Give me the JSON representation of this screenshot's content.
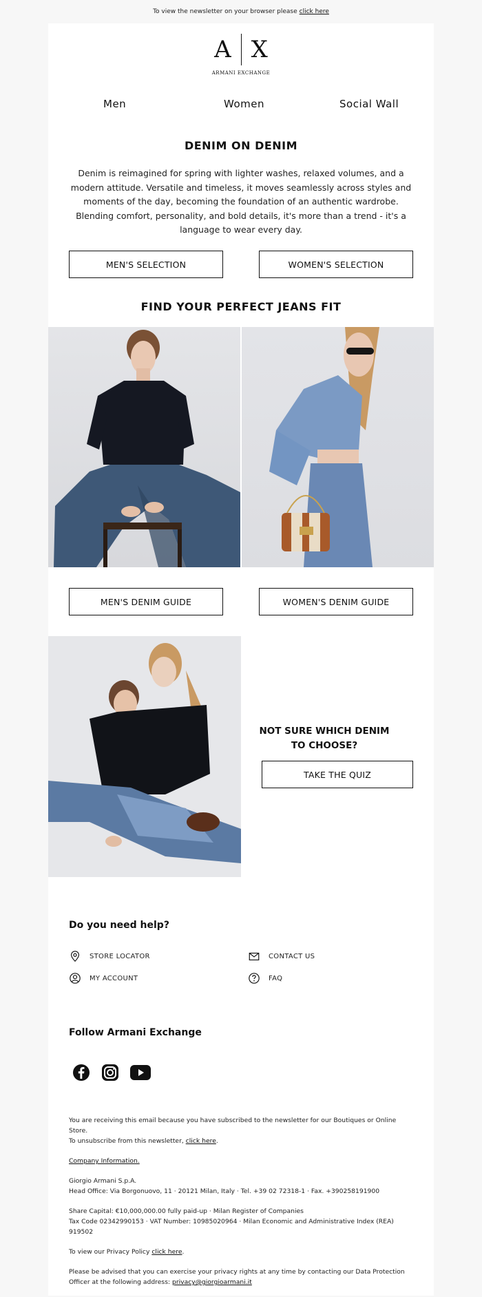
{
  "topbar": {
    "text": "To view the newsletter on your browser please",
    "link": "click here"
  },
  "brand": {
    "mark_left": "A",
    "mark_right": "X",
    "name": "ARMANI EXCHANGE"
  },
  "nav": {
    "items": [
      "Men",
      "Women",
      "Social Wall"
    ]
  },
  "section1": {
    "title": "DENIM ON DENIM",
    "body": "Denim is reimagined for spring with lighter washes, relaxed volumes, and a modern attitude. Versatile and timeless, it moves seamlessly across styles and moments of the day, becoming the foundation of an authentic wardrobe. Blending comfort, personality, and bold details, it's more than a trend - it's a language to wear every day.",
    "btn_men": "MEN'S SELECTION",
    "btn_women": "WOMEN'S SELECTION"
  },
  "section2": {
    "title": "FIND YOUR PERFECT JEANS FIT",
    "btn_men": "MEN'S DENIM GUIDE",
    "btn_women": "WOMEN'S DENIM GUIDE"
  },
  "quiz": {
    "title": "NOT SURE WHICH DENIM TO CHOOSE?",
    "button": "TAKE THE QUIZ"
  },
  "help": {
    "title": "Do you need help?",
    "items": [
      "STORE LOCATOR",
      "CONTACT US",
      "MY ACCOUNT",
      "FAQ"
    ]
  },
  "follow": {
    "title": "Follow Armani Exchange",
    "icons": [
      "facebook-icon",
      "instagram-icon",
      "youtube-icon"
    ]
  },
  "footer": {
    "line1": "You are receiving this email because you have subscribed to the newsletter for our Boutiques or Online Store.",
    "line2": "To unsubscribe from this newsletter,",
    "line2_link": "click here",
    "company_link": "Company Information.",
    "company_name": "Giorgio Armani S.p.A.",
    "head_office": "Head Office: Via Borgonuovo, 11 · 20121 Milan, Italy · Tel. +39 02 72318-1 · Fax. +390258191900",
    "share_capital": "Share Capital: €10,000,000.00 fully paid-up · Milan Register of Companies",
    "tax": "Tax Code 02342990153 · VAT Number: 10985020964 · Milan Economic and Administrative Index (REA) 919502",
    "privacy_text": "To view our Privacy Policy",
    "privacy_link": "click here",
    "dpo_text": "Please be advised that you can exercise your privacy rights at any time by contacting our Data Protection Officer at the following address:",
    "dpo_email": "privacy@giorgioarmani.it"
  }
}
